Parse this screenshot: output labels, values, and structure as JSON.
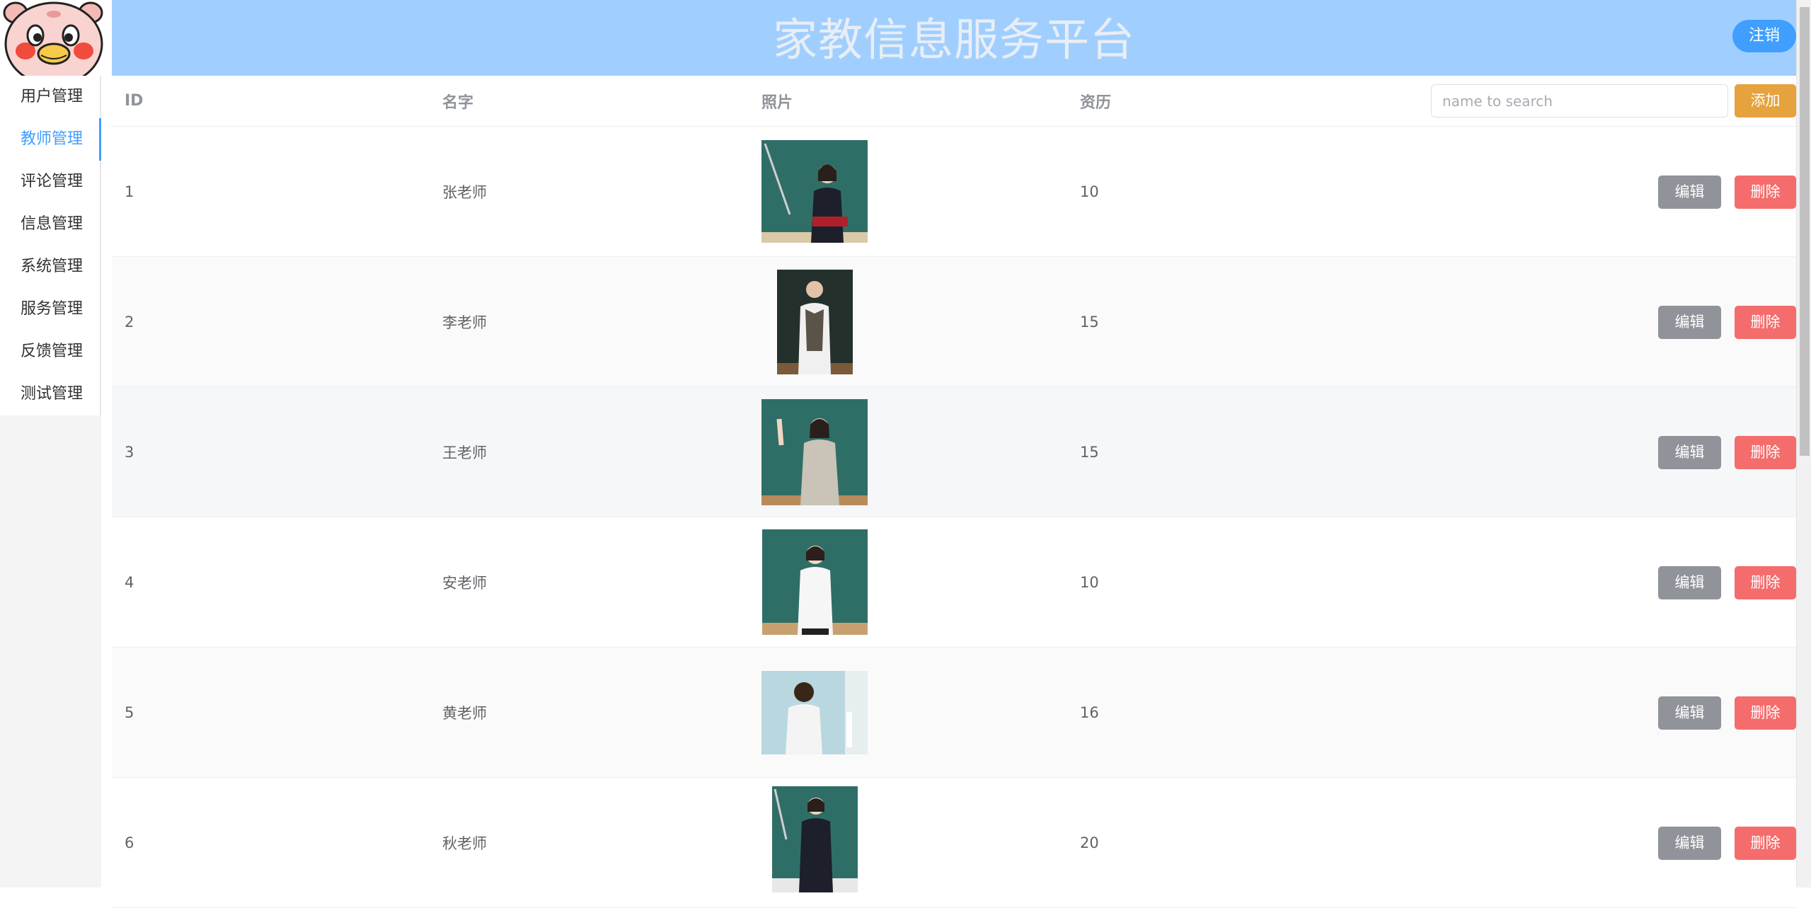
{
  "header": {
    "title": "家教信息服务平台",
    "logout_label": "注销"
  },
  "sidebar": {
    "items": [
      {
        "label": "用户管理",
        "active": false
      },
      {
        "label": "教师管理",
        "active": true
      },
      {
        "label": "评论管理",
        "active": false
      },
      {
        "label": "信息管理",
        "active": false
      },
      {
        "label": "系统管理",
        "active": false
      },
      {
        "label": "服务管理",
        "active": false
      },
      {
        "label": "反馈管理",
        "active": false
      },
      {
        "label": "测试管理",
        "active": false
      }
    ]
  },
  "table": {
    "columns": {
      "id": "ID",
      "name": "名字",
      "photo": "照片",
      "experience": "资历"
    },
    "search_placeholder": "name to search",
    "add_label": "添加",
    "edit_label": "编辑",
    "delete_label": "删除",
    "rows": [
      {
        "id": "1",
        "name": "张老师",
        "experience": "10"
      },
      {
        "id": "2",
        "name": "李老师",
        "experience": "15"
      },
      {
        "id": "3",
        "name": "王老师",
        "experience": "15"
      },
      {
        "id": "4",
        "name": "安老师",
        "experience": "10"
      },
      {
        "id": "5",
        "name": "黄老师",
        "experience": "16"
      },
      {
        "id": "6",
        "name": "秋老师",
        "experience": "20"
      }
    ]
  },
  "colors": {
    "header_bg": "#a0cfff",
    "primary": "#409eff",
    "warning": "#e6a23c",
    "info": "#909399",
    "danger": "#f56c6c",
    "chalkboard": "#2f6e66"
  }
}
